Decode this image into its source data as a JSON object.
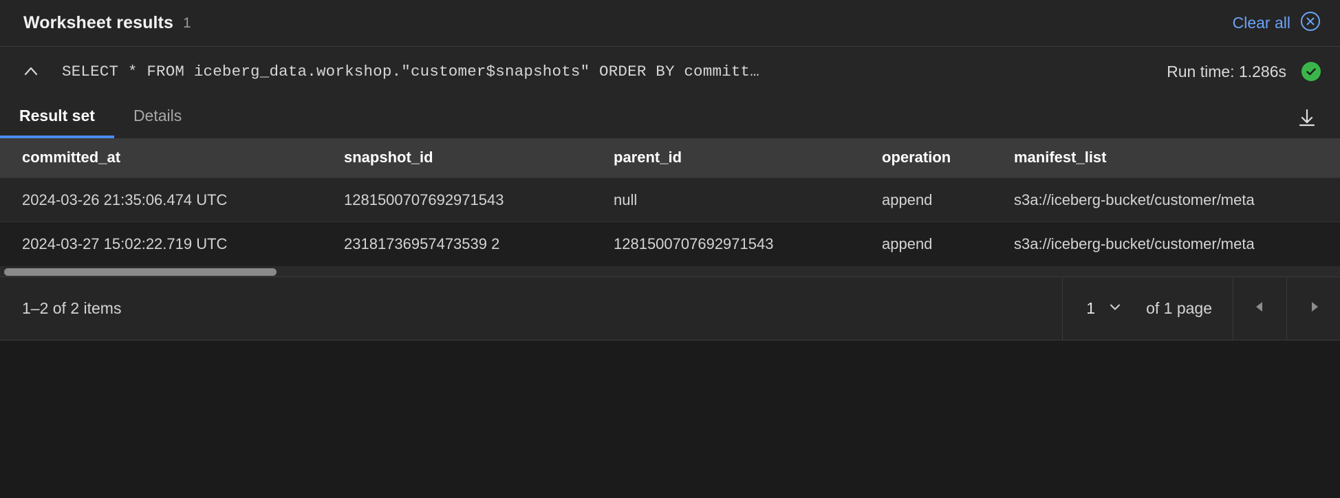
{
  "header": {
    "title": "Worksheet results",
    "count": "1",
    "clear_all_label": "Clear all",
    "clear_icon": "close-circle-icon"
  },
  "query_bar": {
    "collapse_icon": "chevron-up-icon",
    "sql": "SELECT * FROM iceberg_data.workshop.\"customer$snapshots\" ORDER BY committ…",
    "runtime_label": "Run time: 1.286s",
    "status_icon": "check-circle-icon",
    "status_color": "#3ab54a"
  },
  "tabs": {
    "items": [
      {
        "label": "Result set",
        "active": true
      },
      {
        "label": "Details",
        "active": false
      }
    ],
    "download_icon": "download-icon",
    "active_underline_color": "#4a8df0"
  },
  "table": {
    "columns": [
      "committed_at",
      "snapshot_id",
      "parent_id",
      "operation",
      "manifest_list"
    ],
    "rows": [
      [
        "2024-03-26 21:35:06.474 UTC",
        "1281500707692971543",
        "null",
        "append",
        "s3a://iceberg-bucket/customer/meta"
      ],
      [
        "2024-03-27 15:02:22.719 UTC",
        "23181736957473539 2",
        "1281500707692971543",
        "append",
        "s3a://iceberg-bucket/customer/meta"
      ]
    ]
  },
  "footer": {
    "items_label": "1–2 of 2 items",
    "page_value": "1",
    "page_chevron_icon": "chevron-down-icon",
    "of_pages_label": "of 1 page",
    "prev_icon": "chevron-left-icon",
    "next_icon": "chevron-right-icon"
  },
  "colors": {
    "accent_blue": "#4a8df0",
    "link_blue": "#6ba4f8",
    "success_green": "#3ab54a",
    "panel_bg": "#262626",
    "header_row_bg": "#3b3b3b"
  }
}
